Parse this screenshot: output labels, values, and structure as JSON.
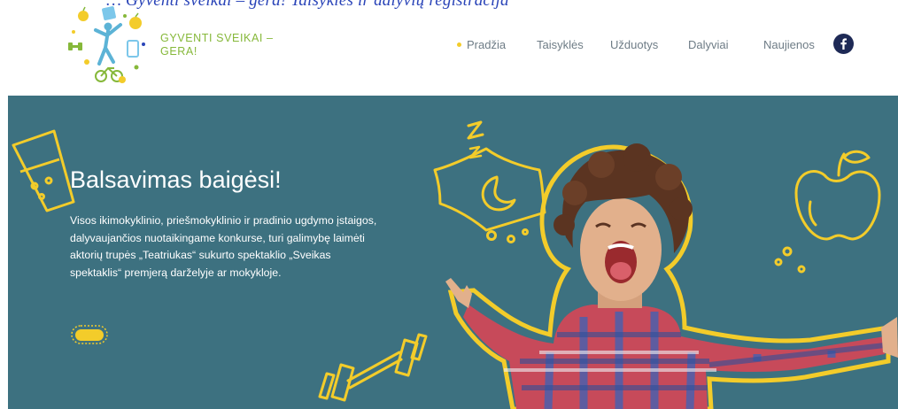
{
  "top_strip": {
    "text": "… Gyventi sveikai – gera! Taisyklės ir dalyvių registracija"
  },
  "header": {
    "brand": {
      "line1": "GYVENTI SVEIKAI –",
      "line2": "GERA!"
    }
  },
  "nav": {
    "items": [
      {
        "label": "Pradžia",
        "active": true
      },
      {
        "label": "Taisyklės",
        "active": false
      },
      {
        "label": "Užduotys",
        "active": false
      },
      {
        "label": "Dalyviai",
        "active": false
      },
      {
        "label": "Naujienos",
        "active": false
      }
    ],
    "facebook_icon": "facebook-icon"
  },
  "hero": {
    "title": "Balsavimas baigėsi!",
    "text": "Visos ikimokyklinio, priešmokyklinio ir pradinio ugdymo įstaigos, dalyvaujančios nuotaikingame konkurse, turi galimybę laimėti aktorių trupės „Teatriukas“ sukurto spektaklio „Sveikas spektaklis“ premjerą darželyje ar mokykloje.",
    "decorations": [
      "glass-icon",
      "pillow-moon-icon",
      "apple-icon",
      "dumbbell-icon",
      "bubbles-icon"
    ],
    "photo": "happy-child-photo"
  },
  "colors": {
    "hero_bg": "#3d7180",
    "accent_yellow": "#f3cc2a",
    "brand_green": "#86b83a",
    "nav_text": "#6e7c86",
    "facebook_bg": "#1e2a56"
  }
}
